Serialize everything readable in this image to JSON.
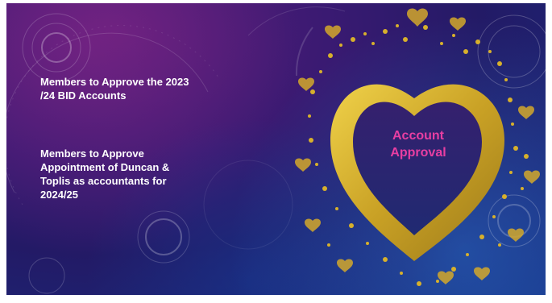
{
  "slide": {
    "bullets": [
      "Members to Approve the 2023 /24 BID Accounts",
      "Members to Approve Appointment of Duncan & Toplis as accountants for 2024/25"
    ],
    "heart_title_line1": "Account",
    "heart_title_line2": "Approval"
  },
  "colors": {
    "background_top": "#3a1a72",
    "background_bottom": "#172c7e",
    "heart_gold": "#d9b52a",
    "title_pink": "#e83ea2",
    "text_white": "#ffffff"
  }
}
